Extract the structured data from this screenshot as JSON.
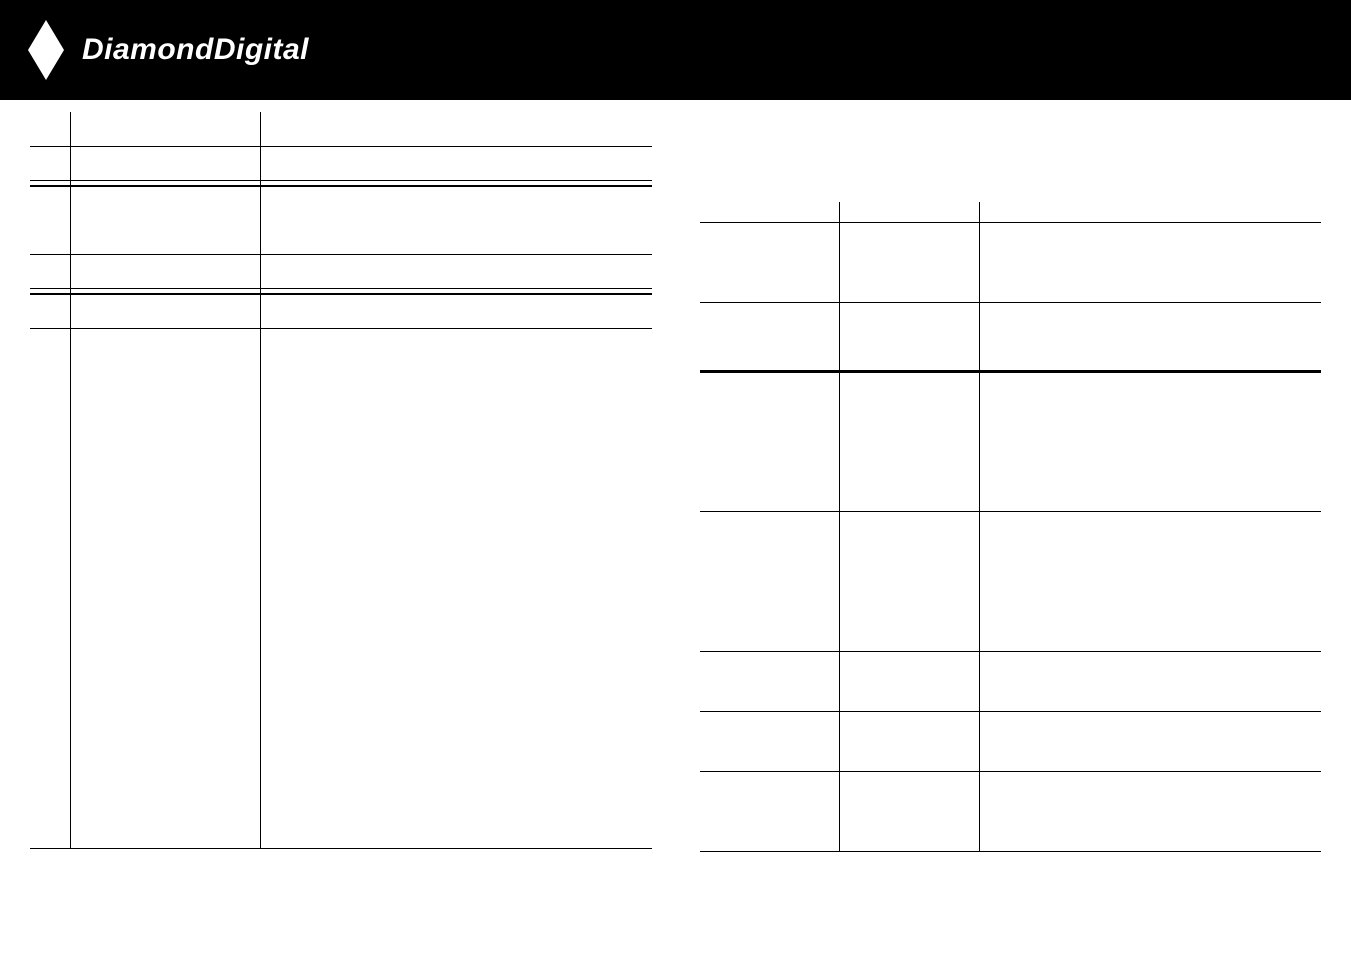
{
  "brand": "DiamondDigital",
  "left": {
    "rows": [
      {
        "num": "",
        "label": "",
        "desc": ""
      },
      {
        "num": "",
        "label": "",
        "desc": ""
      },
      {
        "num": "",
        "label": "",
        "desc": ""
      },
      {
        "num": "",
        "label": "",
        "desc": ""
      },
      {
        "num": "",
        "label": "",
        "desc": ""
      },
      {
        "num": "",
        "label": "",
        "desc": ""
      }
    ]
  },
  "right": {
    "heading": "",
    "sub": "",
    "headers": [
      "",
      "",
      ""
    ],
    "rows": [
      {
        "a": "",
        "b": "",
        "c": ""
      },
      {
        "a": "",
        "b": "",
        "c": ""
      },
      {
        "a": "",
        "b": "",
        "c": ""
      },
      {
        "a": "",
        "b": "",
        "c": ""
      },
      {
        "a": "",
        "b": "",
        "c": ""
      },
      {
        "a": "",
        "b": "",
        "c": ""
      },
      {
        "a": "",
        "b": "",
        "c": ""
      }
    ]
  }
}
